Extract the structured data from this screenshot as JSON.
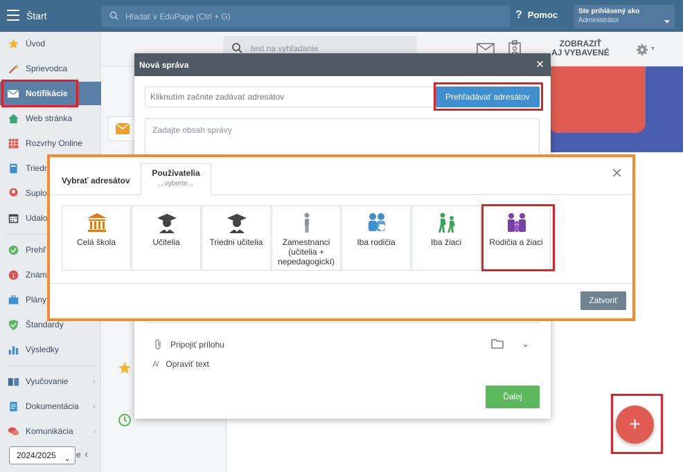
{
  "topbar": {
    "title": "Štart",
    "search_placeholder": "Hľadať v EduPage (Ctrl + G)",
    "help_label": "Pomoc",
    "user_line1": "Ste prihlásený ako",
    "user_line2": "Administrátor"
  },
  "sidebar": {
    "items": [
      {
        "label": "Úvod",
        "icon": "star-icon"
      },
      {
        "label": "Sprievodca",
        "icon": "wand-icon"
      },
      {
        "label": "Notifikácie",
        "icon": "mail-icon"
      },
      {
        "label": "Web stránka",
        "icon": "home-icon"
      },
      {
        "label": "Rozvrhy Online",
        "icon": "grid-icon"
      },
      {
        "label": "Triedn",
        "icon": "book-icon"
      },
      {
        "label": "Suplo",
        "icon": "person-icon"
      },
      {
        "label": "Udalo",
        "icon": "calendar-icon"
      },
      {
        "label": "Prehľ",
        "icon": "check-circle-icon"
      },
      {
        "label": "Znám",
        "icon": "grade-icon"
      },
      {
        "label": "Plány",
        "icon": "briefcase-icon"
      },
      {
        "label": "Štandardy",
        "icon": "shield-icon"
      },
      {
        "label": "Výsledky",
        "icon": "bar-chart-icon"
      },
      {
        "label": "Vyučovanie",
        "icon": "books-icon"
      },
      {
        "label": "Dokumentácia",
        "icon": "document-icon"
      },
      {
        "label": "Komunikácia",
        "icon": "chat-icon"
      }
    ],
    "year": "2024/2025",
    "year_suffix": "e"
  },
  "main": {
    "search_placeholder": "text na vyhľadanie",
    "show_selected_line1": "ZOBRAZIŤ",
    "show_selected_line2": "AJ VYBAVENÉ"
  },
  "compose": {
    "title": "Nová správa",
    "recipients_placeholder": "Kliknutím začnite zadávať adresátov",
    "browse_label": "Prehľadávať adresátov",
    "message_placeholder": "Zadajte obsah správy",
    "attach_label": "Pripojiť prílohu",
    "correct_label": "Opraviť text",
    "next_label": "Ďalej"
  },
  "picker": {
    "tab_select": "Vybrať adresátov",
    "tab_users": "Používatelia",
    "tab_users_sub": "...vyberte...",
    "tiles": [
      {
        "label": "Celá škola",
        "icon": "school-icon"
      },
      {
        "label": "Učitelia",
        "icon": "teacher-icon"
      },
      {
        "label": "Triedni učitelia",
        "icon": "class-teacher-icon"
      },
      {
        "label": "Zamestnanci (učitelia + nepedagogickí)",
        "icon": "employee-icon"
      },
      {
        "label": "Iba rodičia",
        "icon": "parents-icon"
      },
      {
        "label": "Iba žiaci",
        "icon": "students-icon"
      },
      {
        "label": "Rodičia a žiaci",
        "icon": "family-icon"
      }
    ],
    "close_label": "Zatvoriť"
  },
  "fab": {
    "label": "+"
  },
  "colors": {
    "topbar": "#3f6b8f",
    "accent_blue": "#3f8fd0",
    "next_green": "#5cb85c",
    "picker_border": "#f58a2a",
    "highlight_red": "#e0202a",
    "fab_red": "#e05c52"
  }
}
